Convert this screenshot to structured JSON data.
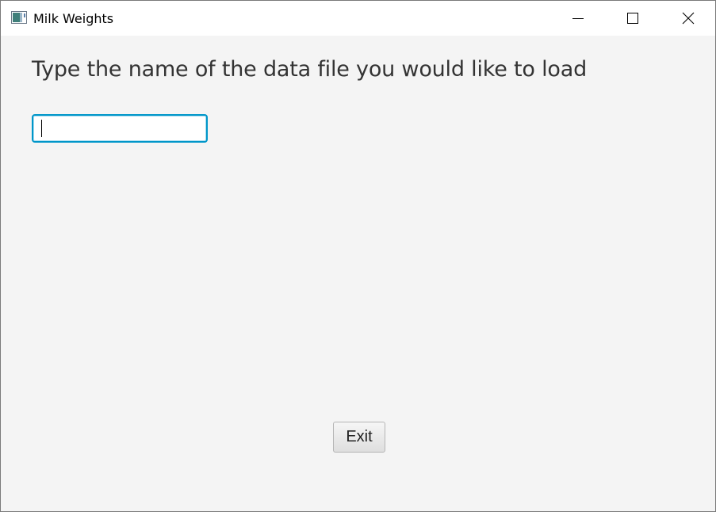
{
  "window": {
    "title": "Milk Weights",
    "app_icon": "java-app-icon",
    "controls": {
      "minimize_icon": "minimize-icon",
      "maximize_icon": "maximize-icon",
      "close_icon": "close-icon"
    }
  },
  "main": {
    "prompt": "Type the name of the data file you would like to load",
    "file_input": {
      "value": "",
      "placeholder": ""
    },
    "exit_label": "Exit"
  },
  "colors": {
    "focus_border": "#0096c9",
    "background": "#f4f4f4",
    "titlebar": "#ffffff"
  }
}
